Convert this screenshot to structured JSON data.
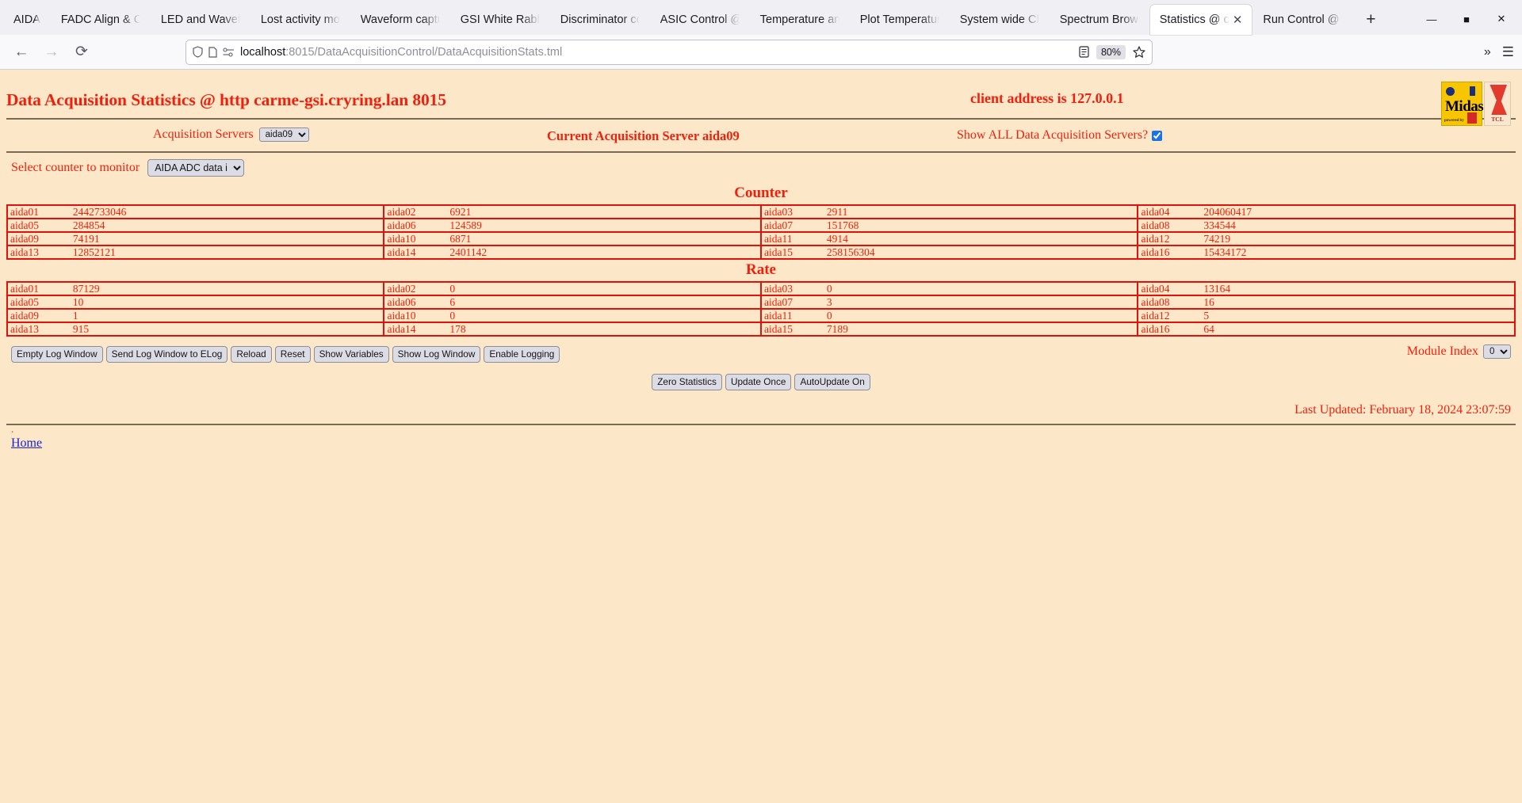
{
  "browser": {
    "tabs": [
      {
        "label": "AIDA",
        "active": false
      },
      {
        "label": "FADC Align & C",
        "active": false
      },
      {
        "label": "LED and Wavefo",
        "active": false
      },
      {
        "label": "Lost activity mo",
        "active": false
      },
      {
        "label": "Waveform captu",
        "active": false
      },
      {
        "label": "GSI White Rabbi",
        "active": false
      },
      {
        "label": "Discriminator co",
        "active": false
      },
      {
        "label": "ASIC Control @",
        "active": false
      },
      {
        "label": "Temperature an",
        "active": false
      },
      {
        "label": "Plot Temperatur",
        "active": false
      },
      {
        "label": "System wide Ch",
        "active": false
      },
      {
        "label": "Spectrum Brows",
        "active": false
      },
      {
        "label": "Statistics @ c",
        "active": true
      },
      {
        "label": "Run Control @ c",
        "active": false
      }
    ],
    "new_tab_label": "+",
    "close_tab_label": "✕",
    "window_controls": {
      "minimize": "—",
      "maximize": "■",
      "close": "✕"
    },
    "nav": {
      "back": "←",
      "forward": "→",
      "reload": "⟳"
    },
    "url": {
      "host": "localhost",
      "path": ":8015/DataAcquisitionControl/DataAcquisitionStats.tml"
    },
    "zoom_level": "80%",
    "reader_icon": "reader-mode-icon",
    "bookmark_icon": "star-icon",
    "overflow_icon": "»",
    "menu_icon": "☰"
  },
  "page": {
    "title": "Data Acquisition Statistics @ http carme-gsi.cryring.lan 8015",
    "client_address": "client address is 127.0.0.1",
    "logo_midas": "Midas",
    "logo_midas_sub": "powered by",
    "logo_tcl": "TCL",
    "controls": {
      "acquisition_servers_label": "Acquisition Servers",
      "acquisition_servers_value": "aida09",
      "acquisition_servers_options": [
        "aida09"
      ],
      "current_server": "Current Acquisition Server aida09",
      "show_all_label": "Show ALL Data Acquisition Servers?",
      "show_all_checked": true
    },
    "counter_select": {
      "label": "Select counter to monitor",
      "value": "AIDA ADC data items",
      "options": [
        "AIDA ADC data items"
      ]
    },
    "counter_table": {
      "title": "Counter",
      "rows": [
        [
          {
            "name": "aida01",
            "value": "2442733046"
          },
          {
            "name": "aida02",
            "value": "6921"
          },
          {
            "name": "aida03",
            "value": "2911"
          },
          {
            "name": "aida04",
            "value": "204060417"
          }
        ],
        [
          {
            "name": "aida05",
            "value": "284854"
          },
          {
            "name": "aida06",
            "value": "124589"
          },
          {
            "name": "aida07",
            "value": "151768"
          },
          {
            "name": "aida08",
            "value": "334544"
          }
        ],
        [
          {
            "name": "aida09",
            "value": "74191"
          },
          {
            "name": "aida10",
            "value": "6871"
          },
          {
            "name": "aida11",
            "value": "4914"
          },
          {
            "name": "aida12",
            "value": "74219"
          }
        ],
        [
          {
            "name": "aida13",
            "value": "12852121"
          },
          {
            "name": "aida14",
            "value": "2401142"
          },
          {
            "name": "aida15",
            "value": "258156304"
          },
          {
            "name": "aida16",
            "value": "15434172"
          }
        ]
      ]
    },
    "rate_table": {
      "title": "Rate",
      "rows": [
        [
          {
            "name": "aida01",
            "value": "87129"
          },
          {
            "name": "aida02",
            "value": "0"
          },
          {
            "name": "aida03",
            "value": "0"
          },
          {
            "name": "aida04",
            "value": "13164"
          }
        ],
        [
          {
            "name": "aida05",
            "value": "10"
          },
          {
            "name": "aida06",
            "value": "6"
          },
          {
            "name": "aida07",
            "value": "3"
          },
          {
            "name": "aida08",
            "value": "16"
          }
        ],
        [
          {
            "name": "aida09",
            "value": "1"
          },
          {
            "name": "aida10",
            "value": "0"
          },
          {
            "name": "aida11",
            "value": "0"
          },
          {
            "name": "aida12",
            "value": "5"
          }
        ],
        [
          {
            "name": "aida13",
            "value": "915"
          },
          {
            "name": "aida14",
            "value": "178"
          },
          {
            "name": "aida15",
            "value": "7189"
          },
          {
            "name": "aida16",
            "value": "64"
          }
        ]
      ]
    },
    "log_buttons": [
      "Empty Log Window",
      "Send Log Window to ELog",
      "Reload",
      "Reset",
      "Show Variables",
      "Show Log Window",
      "Enable Logging"
    ],
    "module_index": {
      "label": "Module Index",
      "value": "0",
      "options": [
        "0"
      ]
    },
    "action_buttons": [
      "Zero Statistics",
      "Update Once",
      "AutoUpdate On"
    ],
    "last_updated": "Last Updated: February 18, 2024 23:07:59",
    "footer_dot": ".",
    "home_link": "Home"
  },
  "colors": {
    "page_bg": "#fce8c8",
    "text_red": "#f21f0c",
    "table_border": "#e2120a",
    "link_blue": "#1a23d1"
  }
}
